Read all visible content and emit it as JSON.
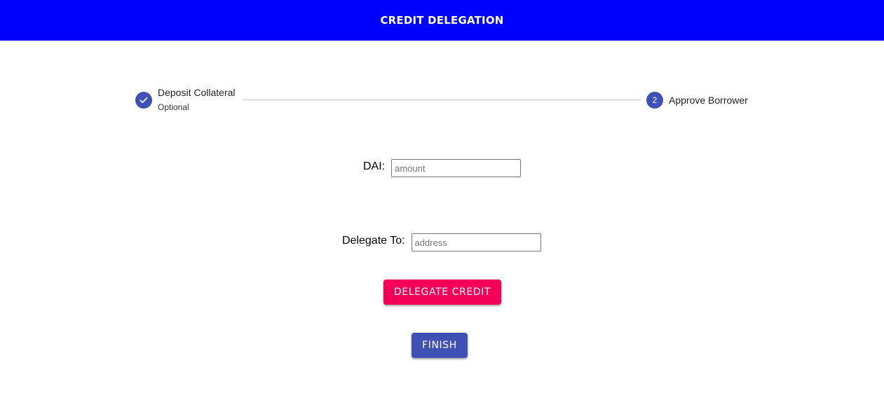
{
  "header": {
    "title": "CREDIT DELEGATION",
    "background": "#0000ff"
  },
  "stepper": {
    "steps": [
      {
        "label": "Deposit Collateral",
        "sublabel": "Optional",
        "state": "completed",
        "icon": "check-icon"
      },
      {
        "label": "Approve Borrower",
        "number": "2",
        "state": "active"
      }
    ],
    "accent": "#3f51b5"
  },
  "form": {
    "dai": {
      "label": "DAI:",
      "placeholder": "amount",
      "value": ""
    },
    "delegate_to": {
      "label": "Delegate To:",
      "placeholder": "address",
      "value": ""
    }
  },
  "actions": {
    "delegate_label": "DELEGATE CREDIT",
    "delegate_color": "#f50057",
    "finish_label": "FINISH",
    "finish_color": "#3f51b5"
  }
}
